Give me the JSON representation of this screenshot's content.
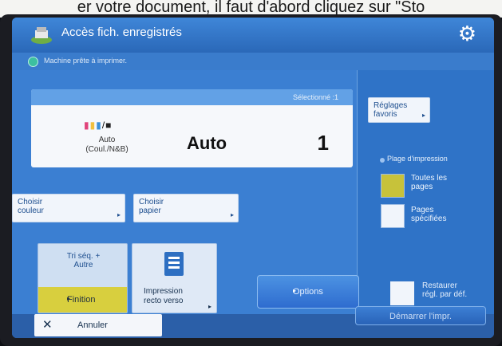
{
  "caption": "er votre document, il faut d'abord cliquez sur \"Sto",
  "header": {
    "title": "Accès fich. enregistrés",
    "settings_icon": "gear-icon"
  },
  "status": {
    "message": "Machine prête à imprimer."
  },
  "summary": {
    "selected": "Sélectionné :1",
    "color_mode_label": "Auto\n(Coul./N&B)",
    "paper_value": "Auto",
    "copies": "1"
  },
  "buttons": {
    "choose_color": "Choisir\ncouleur",
    "choose_paper": "Choisir\npapier",
    "favorites": "Réglages\nfavoris"
  },
  "finishing": {
    "subtitle": "Tri séq. +\nAutre",
    "label": "Finition"
  },
  "duplex": {
    "label": "Impression\nrecto verso"
  },
  "options": {
    "label": "Options"
  },
  "print_range": {
    "label": "Plage d'impression",
    "all_pages": "Toutes les\npages",
    "specified_pages": "Pages\nspécifiées",
    "selected": "all_pages",
    "selected_color": "#c7c23a"
  },
  "restore": {
    "label": "Restaurer\nrégl. par déf."
  },
  "footer": {
    "cancel": "Annuler",
    "start": "Démarrer l'impr."
  },
  "colors": {
    "accent": "#2d6fc2",
    "selected": "#d8cf3e"
  }
}
